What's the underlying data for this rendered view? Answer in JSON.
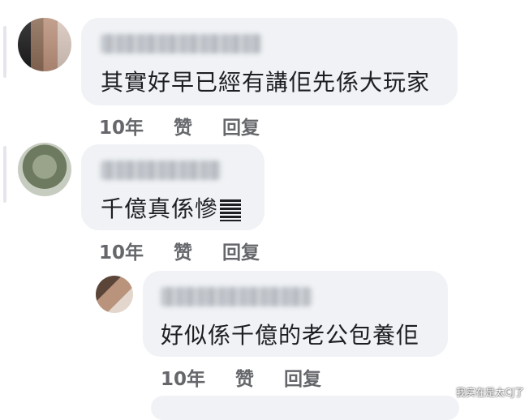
{
  "comments": [
    {
      "text": "其實好早已經有講佢先係大玩家",
      "time": "10年",
      "like": "赞",
      "reply": "回复"
    },
    {
      "text": "千億真係慘",
      "time": "10年",
      "like": "赞",
      "reply": "回复"
    },
    {
      "text": "好似係千億的老公包養佢",
      "time": "10年",
      "like": "赞",
      "reply": "回复"
    }
  ],
  "watermark": "我实在是太CJ了",
  "colors": {
    "bubble": "#f0f2f5",
    "text": "#1c1e21",
    "meta": "#65676b"
  }
}
